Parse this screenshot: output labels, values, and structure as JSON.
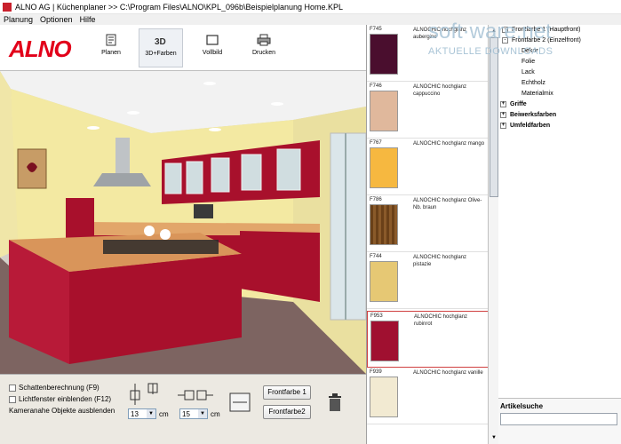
{
  "window": {
    "title": "ALNO AG | Küchenplaner  >>  C:\\Program Files\\ALNO\\KPL_096b\\Beispielplanung Home.KPL"
  },
  "menu": [
    "Planung",
    "Optionen",
    "Hilfe"
  ],
  "toolbar": {
    "logo": "ALNO",
    "buttons": [
      {
        "label": "Planen",
        "icon": "plan-icon"
      },
      {
        "label": "3D+Farben",
        "icon": "3d-icon"
      },
      {
        "label": "Vollbild",
        "icon": "fullscreen-icon"
      },
      {
        "label": "Drucken",
        "icon": "printer-icon"
      }
    ]
  },
  "options": {
    "shadow": "Schattenberechnung (F9)",
    "lightwindow": "Lichtfenster einblenden (F12)",
    "hide_nearby": "Kameranahe Objekte ausblenden"
  },
  "controls": {
    "value1": "13",
    "unit1": "cm",
    "value2": "15",
    "unit2": "cm",
    "front1": "Frontfarbe 1",
    "front2": "Frontfarbe2"
  },
  "palette": [
    {
      "code": "F745",
      "name": "ALNOCHIC hochglanz aubergine",
      "color": "#4a0e2e"
    },
    {
      "code": "F746",
      "name": "ALNOCHIC hochglanz cappuccino",
      "color": "#e0b89c"
    },
    {
      "code": "F767",
      "name": "ALNOCHIC hochglanz mango",
      "color": "#f6b840"
    },
    {
      "code": "F786",
      "name": "ALNOCHIC hochglanz Olive-Nb. braun",
      "color": "#7a4e22"
    },
    {
      "code": "F744",
      "name": "ALNOCHIC hochglanz pistazie",
      "color": "#e6c874"
    },
    {
      "code": "F953",
      "name": "ALNOCHIC hochglanz rubinrot",
      "color": "#a01030"
    },
    {
      "code": "F939",
      "name": "ALNOCHIC hochglanz vanille",
      "color": "#f2ead2"
    }
  ],
  "tree": [
    {
      "label": "Frontfarbe 1 (Hauptfront)",
      "level": 0,
      "pm": "-"
    },
    {
      "label": "Frontfarbe 2 (Einzelfront)",
      "level": 0,
      "pm": "-"
    },
    {
      "label": "Dekor",
      "level": 1
    },
    {
      "label": "Folie",
      "level": 1
    },
    {
      "label": "Lack",
      "level": 1
    },
    {
      "label": "Echtholz",
      "level": 1
    },
    {
      "label": "Materialmix",
      "level": 1
    },
    {
      "label": "Griffe",
      "level": 0,
      "pm": "+"
    },
    {
      "label": "Beiwerksfarben",
      "level": 0,
      "pm": "+"
    },
    {
      "label": "Umfeldfarben",
      "level": 0,
      "pm": "+"
    }
  ],
  "watermark": {
    "main": "soft·ware.net",
    "sub": "AKTUELLE DOWNLOADS"
  },
  "search": {
    "label": "Artikelsuche"
  }
}
